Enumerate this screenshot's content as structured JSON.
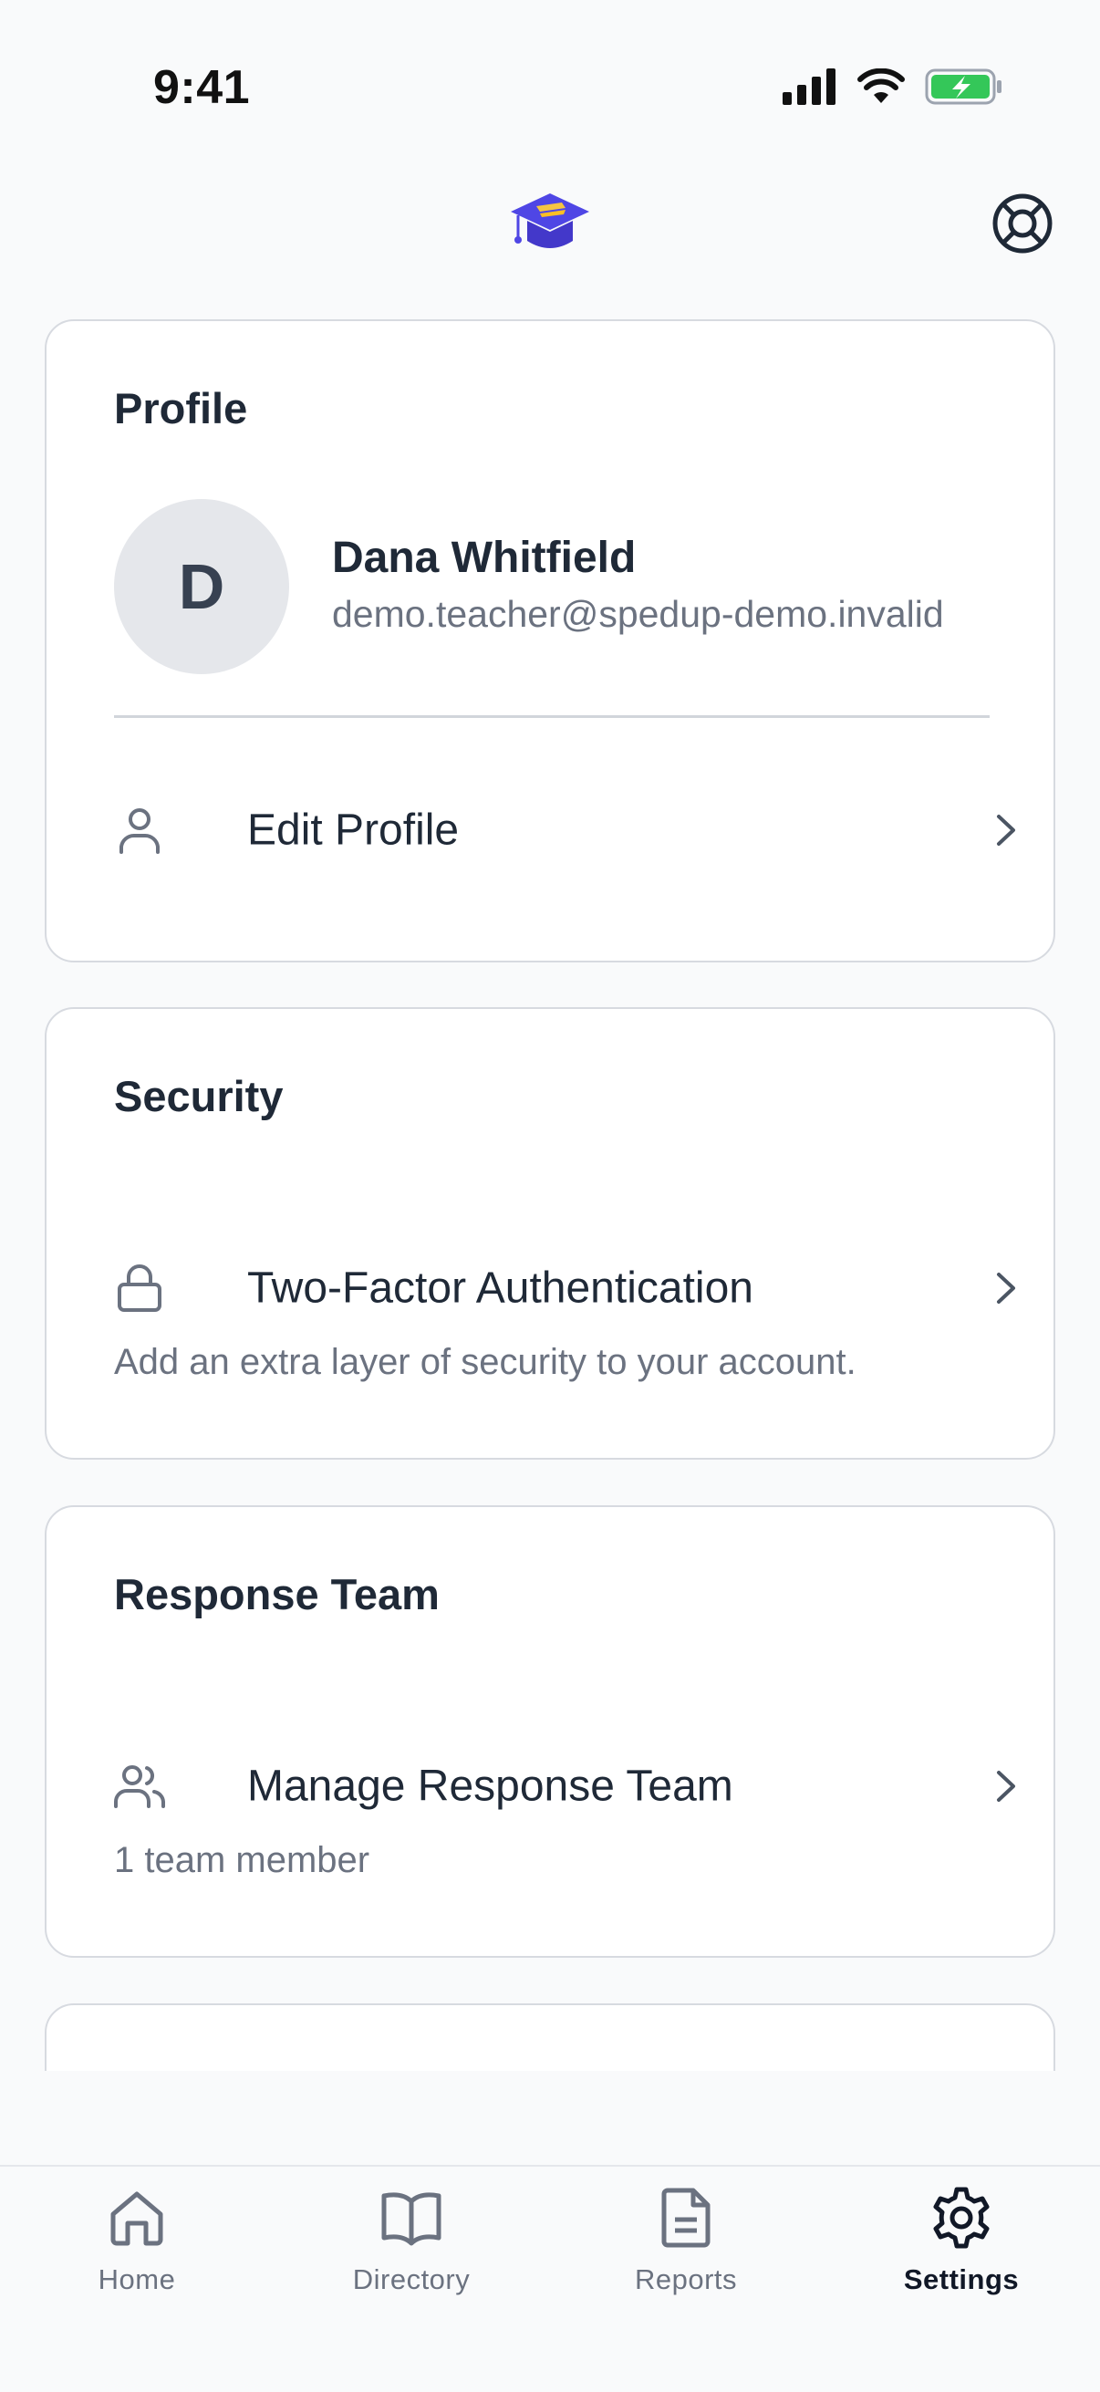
{
  "status_bar": {
    "time": "9:41"
  },
  "profile": {
    "title": "Profile",
    "avatar_initial": "D",
    "name": "Dana Whitfield",
    "email": "demo.teacher@spedup-demo.invalid",
    "edit_label": "Edit Profile"
  },
  "security": {
    "title": "Security",
    "two_factor_label": "Two-Factor Authentication",
    "description": "Add an extra layer of security to your account."
  },
  "response_team": {
    "title": "Response Team",
    "manage_label": "Manage Response Team",
    "member_count": "1 team member"
  },
  "bottom_nav": {
    "items": [
      {
        "label": "Home",
        "icon": "home-icon"
      },
      {
        "label": "Directory",
        "icon": "book-icon"
      },
      {
        "label": "Reports",
        "icon": "document-icon"
      },
      {
        "label": "Settings",
        "icon": "gear-icon",
        "active": true
      }
    ]
  },
  "colors": {
    "brand": "#4f46e5",
    "accent_yellow": "#f5c542",
    "battery_green": "#34c759"
  }
}
